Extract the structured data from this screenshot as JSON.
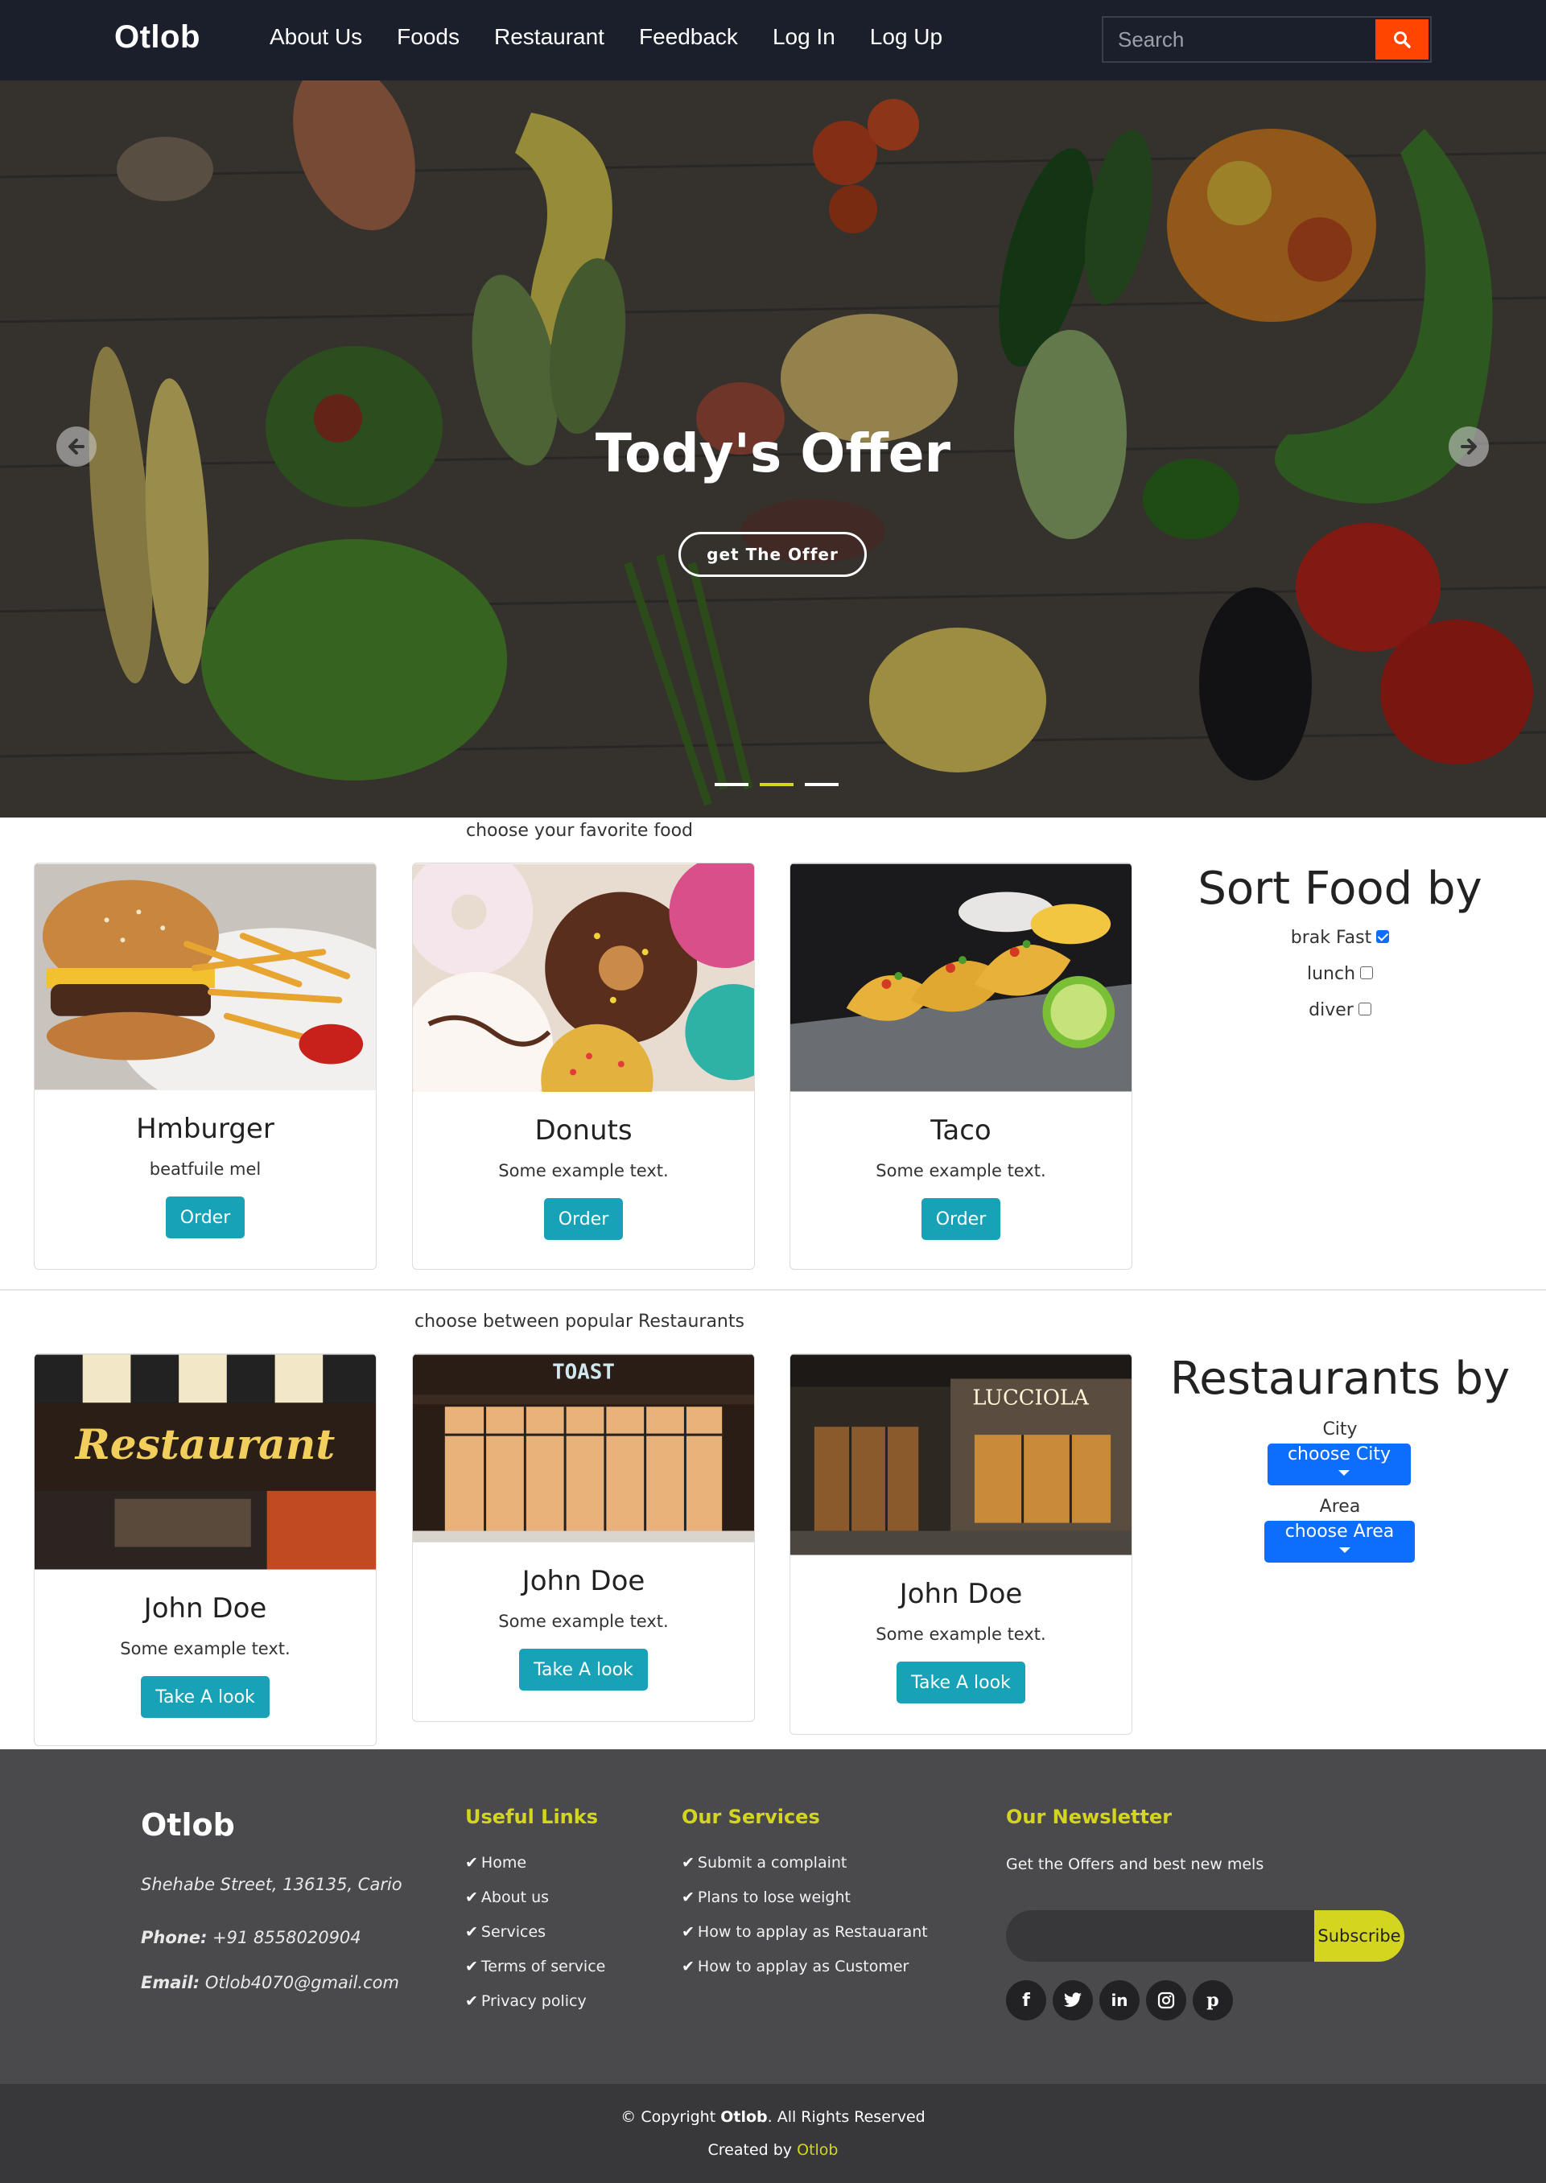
{
  "navbar": {
    "brand": "Otlob",
    "links": [
      "About Us",
      "Foods",
      "Restaurant",
      "Feedback",
      "Log In",
      "Log Up"
    ],
    "search_placeholder": "Search",
    "search_icon": "search-icon"
  },
  "hero": {
    "title": "Tody's Offer",
    "button": "get The Offer",
    "prev_icon": "arrow-left-icon",
    "next_icon": "arrow-right-icon",
    "active_slide": 2,
    "slide_count": 3
  },
  "foods": {
    "caption": "choose your favorite food",
    "cards": [
      {
        "title": "Hmburger",
        "text": "beatfuile mel",
        "button": "Order"
      },
      {
        "title": "Donuts",
        "text": "Some example text.",
        "button": "Order"
      },
      {
        "title": "Taco",
        "text": "Some example text.",
        "button": "Order"
      }
    ],
    "sort": {
      "title": "Sort Food by",
      "options": [
        {
          "label": "brak Fast",
          "checked": true
        },
        {
          "label": "lunch",
          "checked": false
        },
        {
          "label": "diver",
          "checked": false
        }
      ]
    }
  },
  "restaurants": {
    "caption": "choose between popular Restaurants",
    "cards": [
      {
        "title": "John Doe",
        "text": "Some example text.",
        "button": "Take A look",
        "sign": "Restaurant"
      },
      {
        "title": "John Doe",
        "text": "Some example text.",
        "button": "Take A look",
        "sign": "TOAST"
      },
      {
        "title": "John Doe",
        "text": "Some example text.",
        "button": "Take A look",
        "sign": "LUCCIOLA"
      }
    ],
    "filter": {
      "title": "Restaurants by",
      "city_label": "City",
      "city_button": "choose City",
      "area_label": "Area",
      "area_button": "choose Area"
    }
  },
  "footer": {
    "brand": "Otlob",
    "address": "Shehabe Street, 136135, Cario",
    "phone_label": "Phone:",
    "phone": "+91 8558020904",
    "email_label": "Email:",
    "email": "Otlob4070@gmail.com",
    "useful_links_title": "Useful Links",
    "useful_links": [
      "Home",
      "About us",
      "Services",
      "Terms of service",
      "Privacy policy"
    ],
    "services_title": "Our Services",
    "services": [
      "Submit a complaint",
      "Plans to lose weight",
      "How to applay as Restauarant",
      "How to applay as Customer"
    ],
    "newsletter_title": "Our Newsletter",
    "newsletter_text": "Get the Offers and best new mels",
    "subscribe": "Subscribe",
    "socials": [
      "facebook-icon",
      "twitter-icon",
      "linkedin-icon",
      "instagram-icon",
      "pinterest-icon"
    ],
    "copyright_prefix": "© Copyright",
    "copyright_brand": "Otlob",
    "copyright_suffix": ". All Rights Reserved",
    "created_by": "Created by",
    "created_brand": "Otlob"
  },
  "colors": {
    "navbar_bg": "#1b1f2b",
    "search_button": "#ff4500",
    "accent_yellow": "#d4d51f",
    "card_button": "#17a2b8",
    "dropdown_button": "#0d6efd",
    "footer_bg": "#4a4a4c",
    "footer_bottom_bg": "#38383a"
  }
}
